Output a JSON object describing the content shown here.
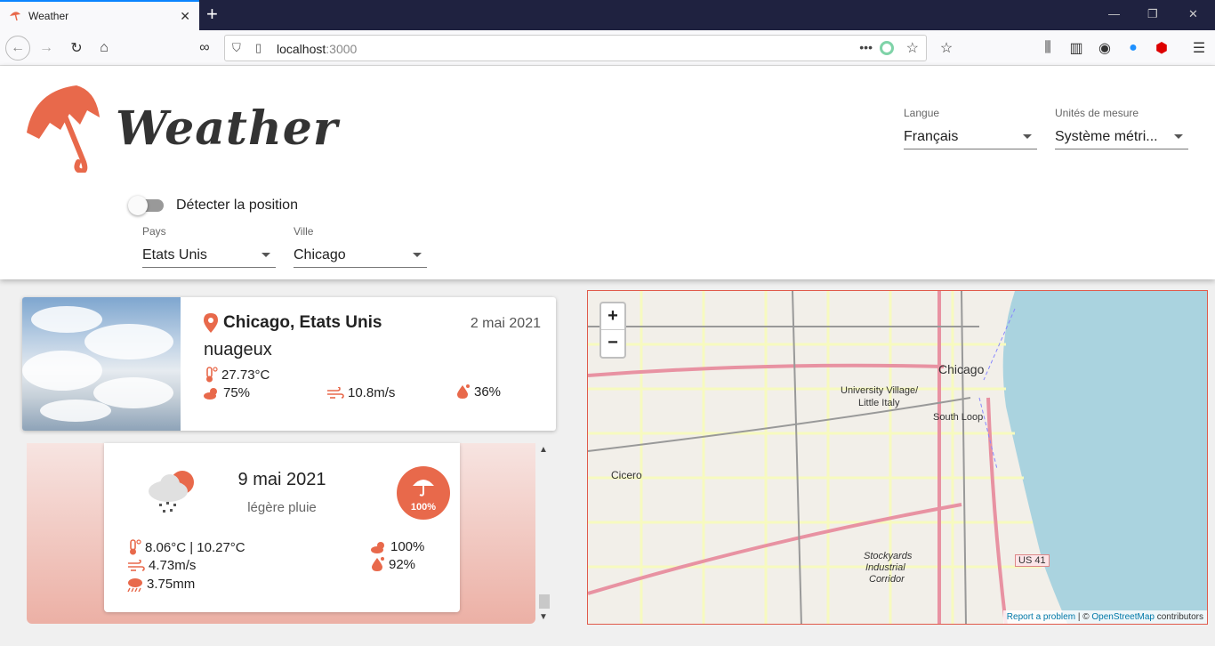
{
  "browser": {
    "tab_title": "Weather",
    "url_host": "localhost",
    "url_port": ":3000"
  },
  "app": {
    "logo_text": "Weather",
    "language": {
      "label": "Langue",
      "value": "Français"
    },
    "units": {
      "label": "Unités de mesure",
      "value": "Système métri..."
    },
    "detect_position_label": "Détecter la position",
    "country": {
      "label": "Pays",
      "value": "Etats Unis"
    },
    "city": {
      "label": "Ville",
      "value": "Chicago"
    }
  },
  "current": {
    "location": "Chicago, Etats Unis",
    "date": "2 mai 2021",
    "description": "nuageux",
    "temperature": "27.73°C",
    "clouds": "75%",
    "wind": "10.8m/s",
    "humidity": "36%"
  },
  "forecast": {
    "date": "9 mai 2021",
    "description": "légère pluie",
    "precip_probability": "100%",
    "temperature_range": "8.06°C | 10.27°C",
    "wind": "4.73m/s",
    "precipitation": "3.75mm",
    "clouds": "100%",
    "humidity": "92%"
  },
  "map": {
    "zoom_in": "+",
    "zoom_out": "−",
    "labels": {
      "chicago": "Chicago",
      "university_village": "University Village/",
      "little_italy": "Little Italy",
      "south_loop": "South Loop",
      "cicero": "Cicero",
      "stockyards": "Stockyards",
      "industrial": "Industrial",
      "corridor": "Corridor",
      "us41": "US 41"
    },
    "attribution_link": "Report a problem",
    "attribution_sep": " | © ",
    "attribution_osm": "OpenStreetMap",
    "attribution_tail": " contributors"
  },
  "colors": {
    "accent": "#e8694b",
    "water": "#aad3df"
  }
}
